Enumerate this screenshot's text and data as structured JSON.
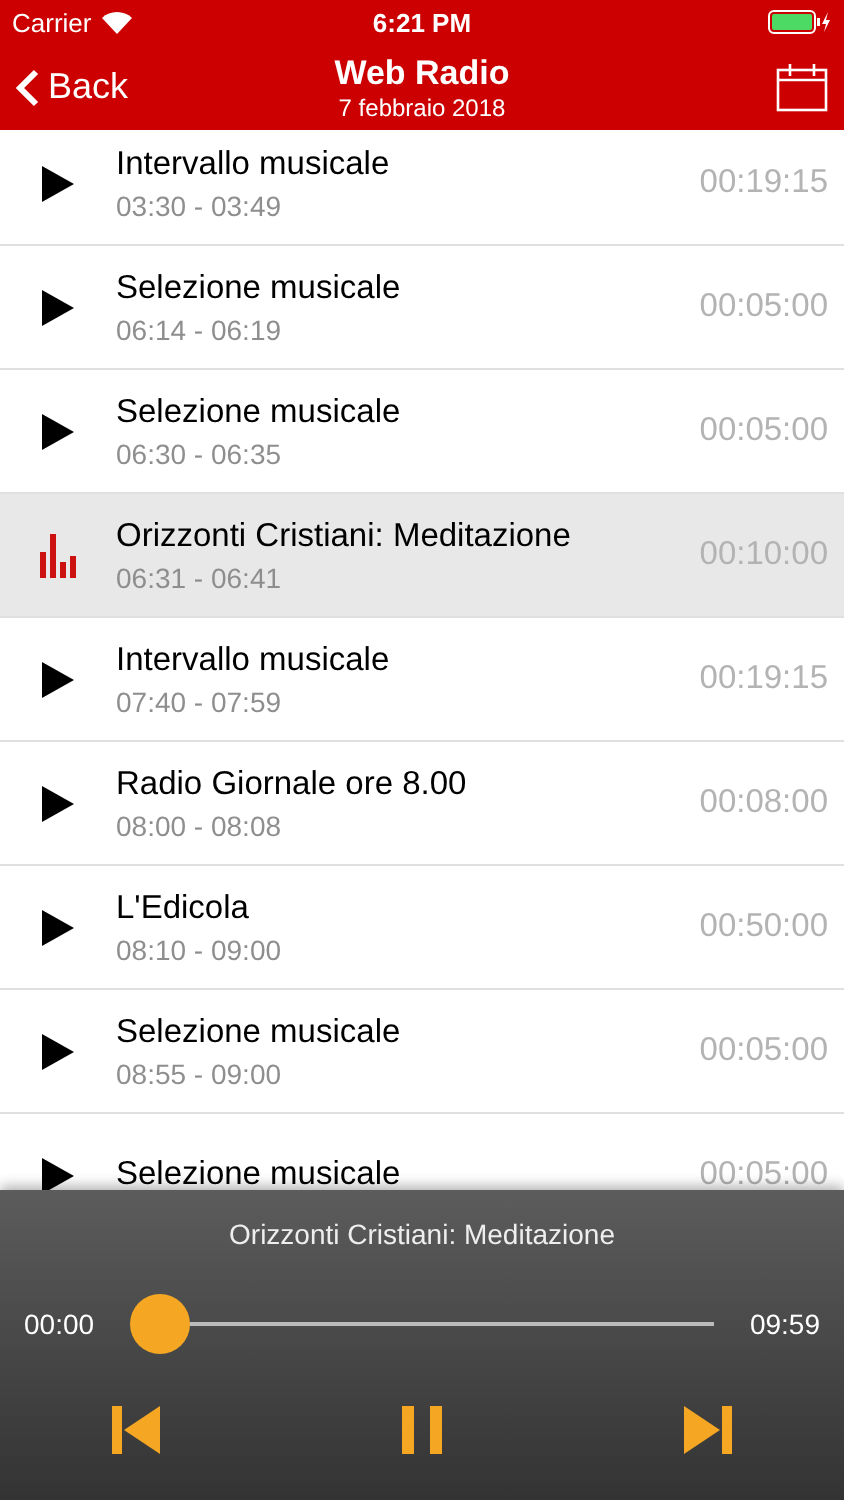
{
  "status_bar": {
    "carrier": "Carrier",
    "time": "6:21 PM"
  },
  "nav": {
    "back": "Back",
    "title": "Web Radio",
    "subtitle": "7 febbraio 2018"
  },
  "programs": [
    {
      "title": "Intervallo musicale",
      "time": "03:30 - 03:49",
      "duration": "00:19:15",
      "selected": false
    },
    {
      "title": "Selezione musicale",
      "time": "06:14 - 06:19",
      "duration": "00:05:00",
      "selected": false
    },
    {
      "title": "Selezione musicale",
      "time": "06:30 - 06:35",
      "duration": "00:05:00",
      "selected": false
    },
    {
      "title": "Orizzonti Cristiani: Meditazione",
      "time": "06:31 - 06:41",
      "duration": "00:10:00",
      "selected": true
    },
    {
      "title": "Intervallo musicale",
      "time": "07:40 - 07:59",
      "duration": "00:19:15",
      "selected": false
    },
    {
      "title": "Radio Giornale ore 8.00",
      "time": "08:00 - 08:08",
      "duration": "00:08:00",
      "selected": false
    },
    {
      "title": "L'Edicola",
      "time": "08:10 - 09:00",
      "duration": "00:50:00",
      "selected": false
    },
    {
      "title": "Selezione musicale",
      "time": "08:55 - 09:00",
      "duration": "00:05:00",
      "selected": false
    },
    {
      "title": "Selezione musicale",
      "duration": "00:05:00",
      "selected": false
    }
  ],
  "player": {
    "title": "Orizzonti Cristiani: Meditazione",
    "elapsed": "00:00",
    "total": "09:59",
    "level": 0,
    "playing": true
  }
}
